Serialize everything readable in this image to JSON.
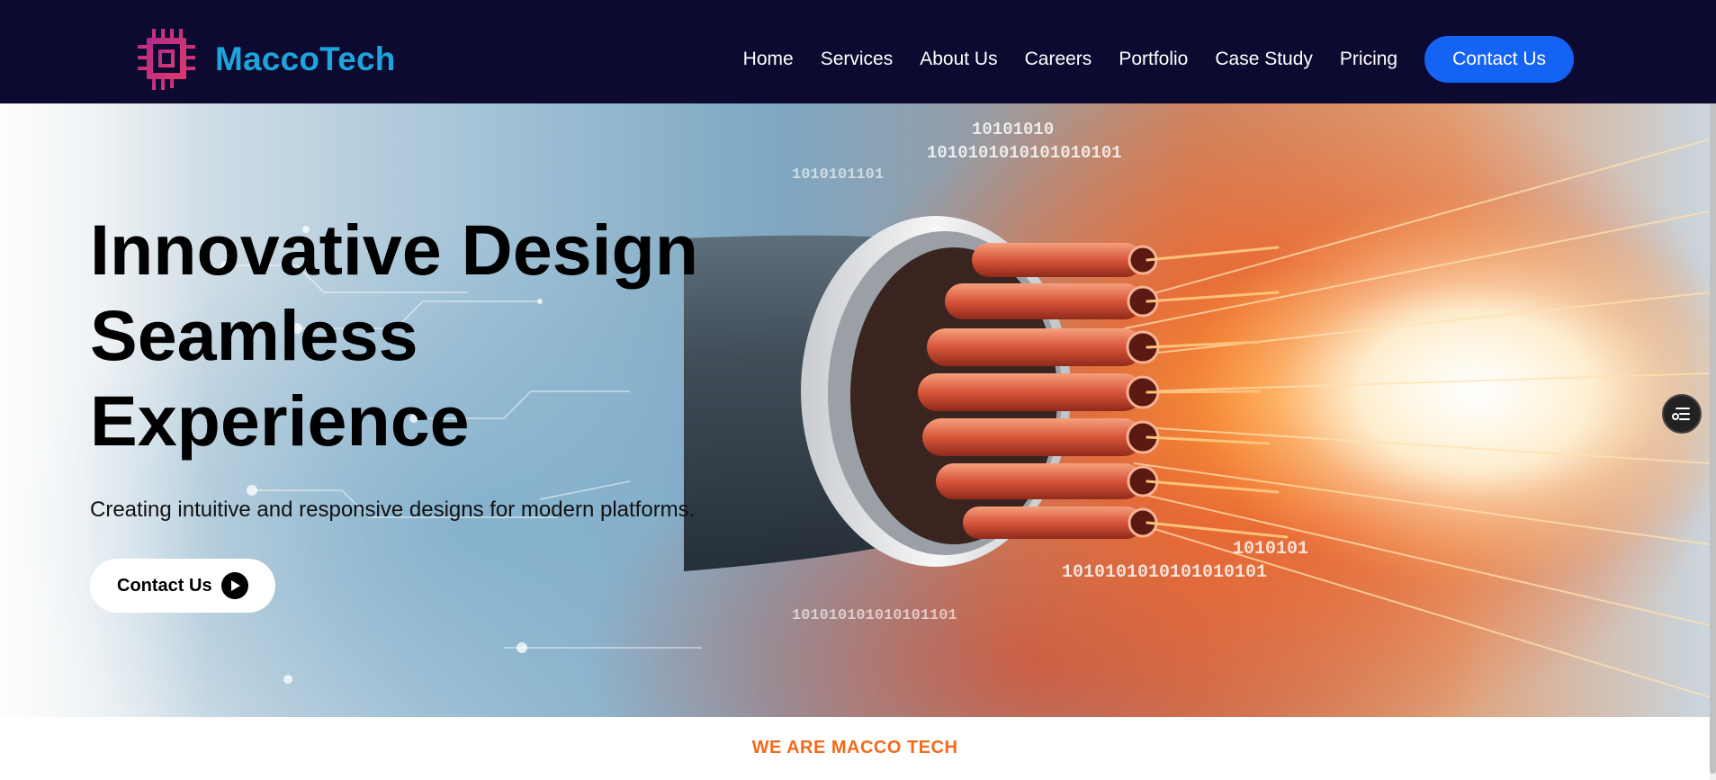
{
  "brand": {
    "name": "MaccoTech",
    "logo_icon": "chip-icon",
    "colors": {
      "header_bg": "#0c0a30",
      "brand_text": "#1ea4dc",
      "logo_pink": "#d62c7c",
      "cta_blue": "#1463f5",
      "eyebrow_orange": "#f26a1b"
    }
  },
  "nav": {
    "items": [
      {
        "label": "Home"
      },
      {
        "label": "Services"
      },
      {
        "label": "About Us"
      },
      {
        "label": "Careers"
      },
      {
        "label": "Portfolio"
      },
      {
        "label": "Case Study"
      },
      {
        "label": "Pricing"
      }
    ],
    "cta_label": "Contact Us"
  },
  "hero": {
    "title_lines": [
      "Innovative Design",
      "Seamless",
      "Experience"
    ],
    "subtitle": "Creating intuitive and responsive designs for modern platforms.",
    "cta_label": "Contact Us",
    "cta_icon": "play-circle-icon",
    "background": "fiber-optic-cable-image"
  },
  "floating_button": {
    "icon": "toggle-settings-icon"
  },
  "section": {
    "eyebrow": "WE ARE MACCO TECH"
  }
}
